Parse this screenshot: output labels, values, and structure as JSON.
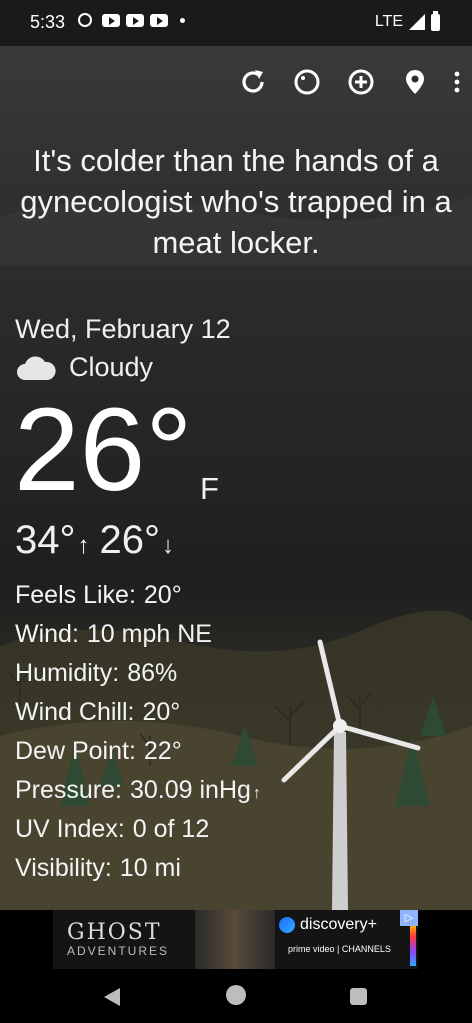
{
  "status_bar": {
    "time": "5:33",
    "network": "LTE",
    "icons": [
      "alarm-icon",
      "youtube-icon",
      "youtube-icon",
      "youtube-icon",
      "notification-dot-icon",
      "signal-icon",
      "battery-icon"
    ]
  },
  "toolbar": {
    "icons": [
      "refresh-icon",
      "weather-theme-icon",
      "add-location-icon",
      "location-pin-icon",
      "more-vert-icon"
    ]
  },
  "quote": "It's colder than the hands of a gynecologist who's trapped in a meat locker.",
  "weather": {
    "date": "Wed, February 12",
    "condition": "Cloudy",
    "condition_icon": "cloud-icon",
    "temperature": "26°",
    "unit": "F",
    "high": "34°",
    "low": "26°",
    "high_arrow": "↑",
    "low_arrow": "↓"
  },
  "details": [
    {
      "label": "Feels Like:",
      "value": "20°"
    },
    {
      "label": "Wind:",
      "value": "10 mph NE"
    },
    {
      "label": "Humidity:",
      "value": "86%"
    },
    {
      "label": "Wind Chill:",
      "value": "20°"
    },
    {
      "label": "Dew Point:",
      "value": "22°"
    },
    {
      "label": "Pressure:",
      "value": "30.09 inHg",
      "trend": "↑"
    },
    {
      "label": "UV Index:",
      "value": "0 of 12"
    },
    {
      "label": "Visibility:",
      "value": "10 mi"
    }
  ],
  "ad": {
    "title": "GHOST",
    "subtitle": "ADVENTURES",
    "brand": "discovery+",
    "partner": "prime video | CHANNELS",
    "badge_icon": "ad-choices-icon"
  },
  "nav_bar": {
    "icons": [
      "back-icon",
      "home-icon",
      "recents-icon"
    ]
  },
  "colors": {
    "background": "#1c1c1c",
    "text": "#ffffff",
    "accent_blue": "#1e6cff"
  }
}
